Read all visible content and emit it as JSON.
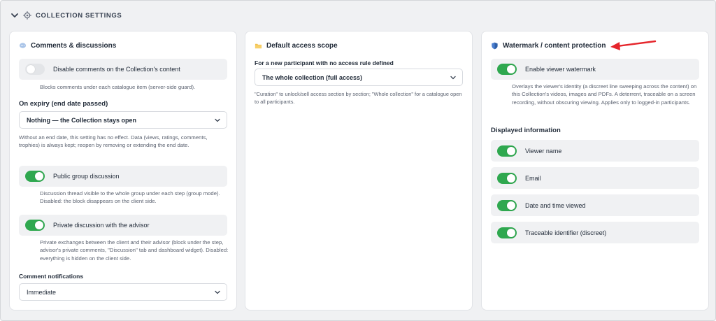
{
  "section": {
    "title": "COLLECTION SETTINGS"
  },
  "comments_card": {
    "title": "Comments & discussions",
    "icon": "speech-bubble-icon",
    "disable_comments": {
      "label": "Disable comments on the Collection's content",
      "enabled": false,
      "help": "Blocks comments under each catalogue item (server-side guard)."
    },
    "on_expiry": {
      "label": "On expiry (end date passed)",
      "selected": "Nothing — the Collection stays open",
      "help": "Without an end date, this setting has no effect. Data (views, ratings, comments, trophies) is always kept; reopen by removing or extending the end date."
    },
    "public_group": {
      "label": "Public group discussion",
      "enabled": true,
      "help": "Discussion thread visible to the whole group under each step (group mode). Disabled: the block disappears on the client side."
    },
    "private_advisor": {
      "label": "Private discussion with the advisor",
      "enabled": true,
      "help": "Private exchanges between the client and their advisor (block under the step, advisor's private comments, \"Discussion\" tab and dashboard widget). Disabled: everything is hidden on the client side."
    },
    "notifications": {
      "label": "Comment notifications",
      "selected": "Immediate"
    }
  },
  "access_card": {
    "title": "Default access scope",
    "icon": "folder-icon",
    "new_participant": {
      "label": "For a new participant with no access rule defined",
      "selected": "The whole collection (full access)",
      "help": "\"Curation\" to unlock/sell access section by section; \"Whole collection\" for a catalogue open to all participants."
    }
  },
  "watermark_card": {
    "title": "Watermark / content protection",
    "icon": "shield-icon",
    "enable": {
      "label": "Enable viewer watermark",
      "enabled": true,
      "help": "Overlays the viewer's identity (a discreet line sweeping across the content) on this Collection's videos, images and PDFs. A deterrent, traceable on a screen recording, without obscuring viewing. Applies only to logged-in participants."
    },
    "displayed_heading": "Displayed information",
    "items": [
      {
        "label": "Viewer name",
        "enabled": true
      },
      {
        "label": "Email",
        "enabled": true
      },
      {
        "label": "Date and time viewed",
        "enabled": true
      },
      {
        "label": "Traceable identifier (discreet)",
        "enabled": true
      }
    ]
  },
  "colors": {
    "toggle_on": "#2fa84f",
    "toggle_off": "#e3e5e8",
    "annotation_arrow": "#e5252b"
  }
}
